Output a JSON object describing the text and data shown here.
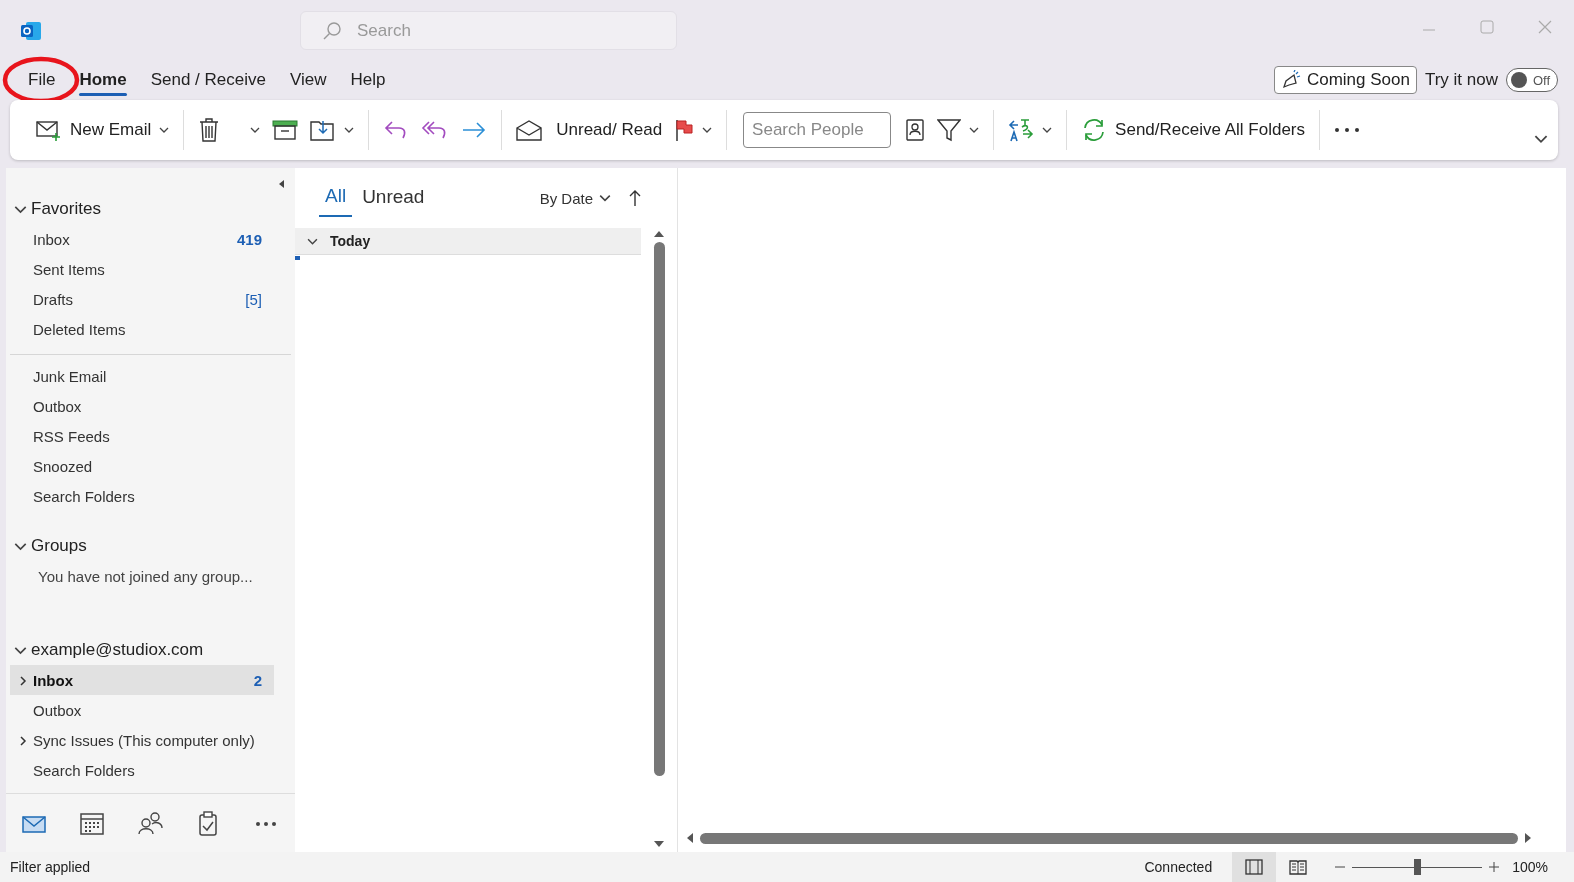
{
  "window": {
    "search_placeholder": "Search"
  },
  "menu": [
    {
      "label": "File",
      "selected": false
    },
    {
      "label": "Home",
      "selected": true
    },
    {
      "label": "Send / Receive",
      "selected": false
    },
    {
      "label": "View",
      "selected": false
    },
    {
      "label": "Help",
      "selected": false
    }
  ],
  "coming_soon": {
    "label": "Coming Soon",
    "try_label": "Try it now",
    "toggle": {
      "on": false,
      "label": "Off"
    }
  },
  "ribbon": {
    "new_email": "New Email",
    "unread_read": "Unread/ Read",
    "search_people_placeholder": "Search People",
    "send_receive_all": "Send/Receive All Folders"
  },
  "favorites": {
    "title": "Favorites",
    "expanded": true,
    "items": [
      {
        "label": "Inbox",
        "count": "419",
        "count_bold": true
      },
      {
        "label": "Sent Items"
      },
      {
        "label": "Drafts",
        "count": "[5]",
        "count_bold": false
      },
      {
        "label": "Deleted Items"
      }
    ]
  },
  "folders": [
    {
      "label": "Junk Email"
    },
    {
      "label": "Outbox"
    },
    {
      "label": "RSS Feeds"
    },
    {
      "label": "Snoozed"
    },
    {
      "label": "Search Folders"
    }
  ],
  "groups": {
    "title": "Groups",
    "expanded": true,
    "note": "You have not joined any group..."
  },
  "account": {
    "title": "example@studiox.com",
    "expanded": true,
    "items": [
      {
        "label": "Inbox",
        "count": "2",
        "selected": true,
        "expanded": false
      },
      {
        "label": "Outbox",
        "selected": false
      },
      {
        "label": "Sync Issues (This computer only)",
        "selected": false,
        "expanded": false
      },
      {
        "label": "Search Folders",
        "selected": false
      }
    ]
  },
  "nav_bar": [
    {
      "selected": true
    },
    {
      "selected": false
    },
    {
      "selected": false
    },
    {
      "selected": false
    },
    {
      "selected": false
    }
  ],
  "message_list": {
    "tabs": [
      {
        "label": "All",
        "selected": true
      },
      {
        "label": "Unread",
        "selected": false
      }
    ],
    "sort": "By Date",
    "group": {
      "label": "Today",
      "expanded": true
    }
  },
  "status_bar": {
    "left": "Filter applied",
    "connection": "Connected",
    "views": [
      {
        "selected": true
      },
      {
        "selected": false
      }
    ],
    "zoom": {
      "level": 0.5,
      "label": "100%"
    }
  }
}
